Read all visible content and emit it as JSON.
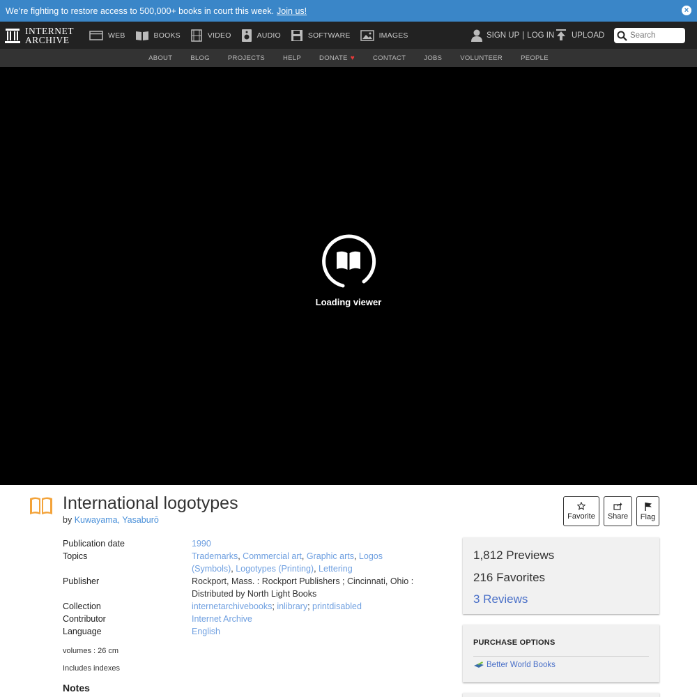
{
  "banner": {
    "message": "We’re fighting to restore access to 500,000+ books in court this week.",
    "link": "Join us!",
    "close_icon": "close-icon"
  },
  "logo": {
    "line1": "INTERNET",
    "line2": "ARCHIVE"
  },
  "media_nav": [
    {
      "label": "WEB",
      "icon": "web-icon"
    },
    {
      "label": "BOOKS",
      "icon": "books-icon"
    },
    {
      "label": "VIDEO",
      "icon": "film-icon"
    },
    {
      "label": "AUDIO",
      "icon": "speaker-icon"
    },
    {
      "label": "SOFTWARE",
      "icon": "floppy-icon"
    },
    {
      "label": "IMAGES",
      "icon": "image-icon"
    }
  ],
  "user": {
    "signup": "SIGN UP",
    "separator": "|",
    "login": "LOG IN",
    "upload": "UPLOAD"
  },
  "search": {
    "placeholder": "Search"
  },
  "subnav": [
    "ABOUT",
    "BLOG",
    "PROJECTS",
    "HELP",
    "DONATE",
    "CONTACT",
    "JOBS",
    "VOLUNTEER",
    "PEOPLE"
  ],
  "viewer": {
    "loading_text": "Loading viewer"
  },
  "item": {
    "title": "International logotypes",
    "by_label": "by",
    "author": "Kuwayama, Yasaburō"
  },
  "actions": {
    "favorite": "Favorite",
    "share": "Share",
    "flag": "Flag"
  },
  "metadata": {
    "publication_date_label": "Publication date",
    "publication_date": "1990",
    "topics_label": "Topics",
    "topics": [
      "Trademarks",
      "Commercial art",
      "Graphic arts",
      "Logos (Symbols)",
      "Logotypes (Printing)",
      "Lettering"
    ],
    "publisher_label": "Publisher",
    "publisher": "Rockport, Mass. : Rockport Publishers ; Cincinnati, Ohio : Distributed by North Light Books",
    "collection_label": "Collection",
    "collections": [
      "internetarchivebooks",
      "inlibrary",
      "printdisabled"
    ],
    "contributor_label": "Contributor",
    "contributor": "Internet Archive",
    "language_label": "Language",
    "language": "English",
    "volumes": "volumes : 26 cm",
    "indexes": "Includes indexes",
    "notes_heading": "Notes"
  },
  "stats": {
    "previews_count": "1,812",
    "previews_label": "Previews",
    "favorites_count": "216",
    "favorites_label": "Favorites",
    "reviews": "3 Reviews"
  },
  "purchase": {
    "heading": "PURCHASE OPTIONS",
    "seller": "Better World Books"
  },
  "colors": {
    "banner": "#3a86c8",
    "nav": "#222222",
    "subnav": "#333333",
    "link": "#6e9fe0",
    "book_orange": "#f3a33a"
  }
}
